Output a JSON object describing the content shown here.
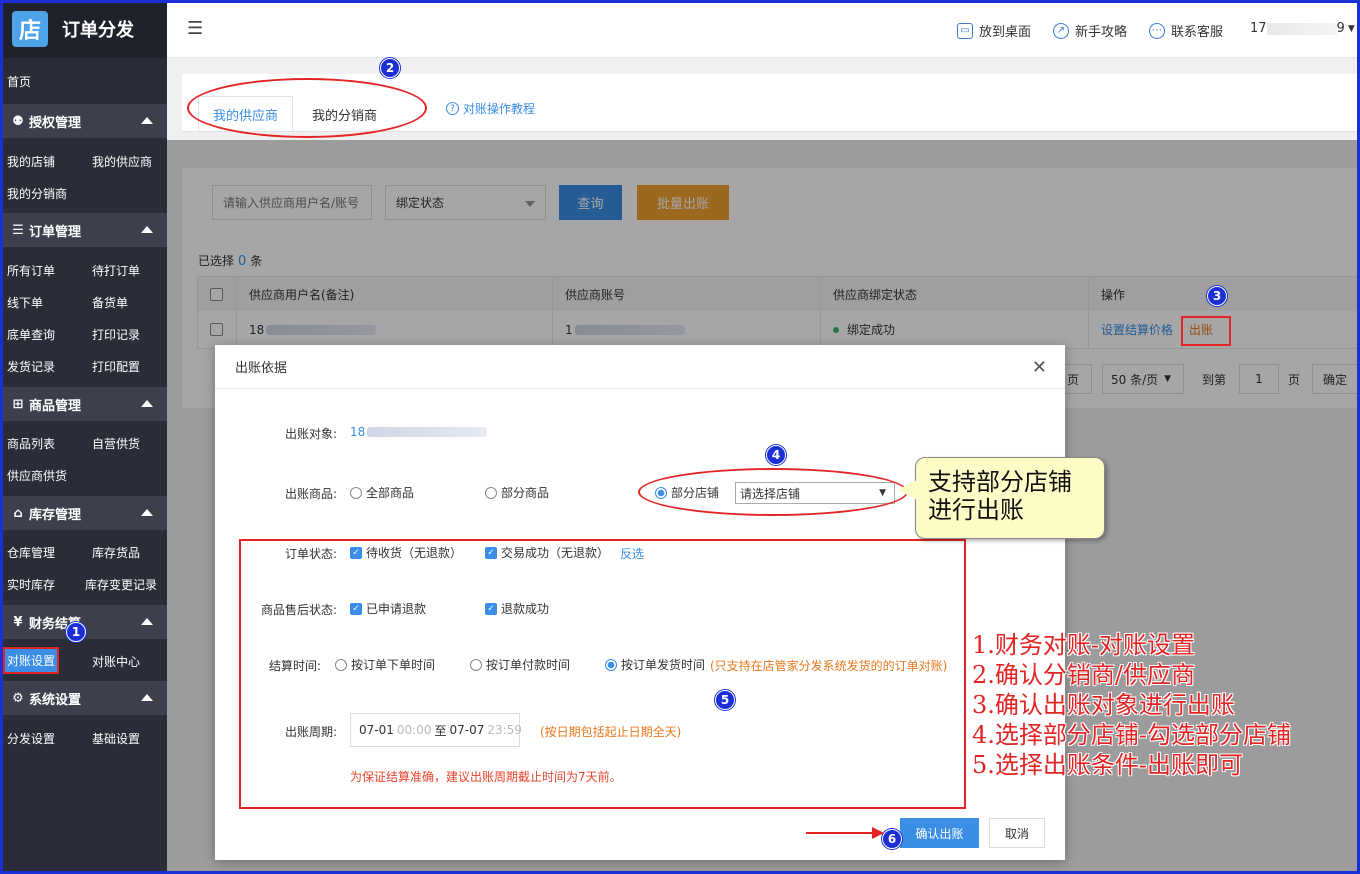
{
  "brand": {
    "logo": "店",
    "title": "订单分发"
  },
  "sidebar": {
    "home": "首页",
    "sections": [
      {
        "title": "授权管理",
        "icon": "user-key-icon",
        "items": [
          "我的店铺",
          "我的供应商",
          "我的分销商"
        ]
      },
      {
        "title": "订单管理",
        "icon": "order-icon",
        "items": [
          "所有订单",
          "待打订单",
          "线下单",
          "备货单",
          "底单查询",
          "打印记录",
          "发货记录",
          "打印配置"
        ]
      },
      {
        "title": "商品管理",
        "icon": "grid-icon",
        "items": [
          "商品列表",
          "自营供货",
          "供应商供货"
        ]
      },
      {
        "title": "库存管理",
        "icon": "home-icon",
        "items": [
          "仓库管理",
          "库存货品",
          "实时库存",
          "库存变更记录"
        ]
      },
      {
        "title": "财务结算",
        "icon": "yen-icon",
        "items": [
          "对账设置",
          "对账中心"
        ]
      },
      {
        "title": "系统设置",
        "icon": "settings-icon",
        "items": [
          "分发设置",
          "基础设置"
        ]
      }
    ]
  },
  "topbar": {
    "actions": [
      "放到桌面",
      "新手攻略",
      "联系客服"
    ],
    "user_prefix": "17",
    "user_suffix": "9"
  },
  "tabs": {
    "items": [
      "我的供应商",
      "我的分销商"
    ],
    "active": 0,
    "help": "对账操作教程"
  },
  "filters": {
    "search_placeholder": "请输入供应商用户名/账号",
    "status_select": "绑定状态",
    "query_btn": "查询",
    "batch_btn": "批量出账"
  },
  "selection": {
    "prefix": "已选择",
    "count": "0",
    "suffix": "条"
  },
  "table": {
    "headers": [
      "供应商用户名(备注)",
      "供应商账号",
      "供应商绑定状态",
      "操作"
    ],
    "rows": [
      {
        "name_prefix": "18",
        "account_prefix": "1",
        "status": "绑定成功",
        "action1": "设置结算价格",
        "action2": "出账"
      }
    ]
  },
  "pager": {
    "page_label": "页",
    "page_size": "50 条/页",
    "goto": "到第",
    "page_no": "1",
    "page_unit": "页",
    "confirm": "确定"
  },
  "modal": {
    "title": "出账依据",
    "target_label": "出账对象:",
    "target_prefix": "18",
    "goods_label": "出账商品:",
    "goods_options": [
      "全部商品",
      "部分商品",
      "部分店铺"
    ],
    "store_select": "请选择店铺",
    "order_status_label": "订单状态:",
    "order_status_opts": [
      "待收货（无退款）",
      "交易成功（无退款）"
    ],
    "invert": "反选",
    "after_sale_label": "商品售后状态:",
    "after_sale_opts": [
      "已申请退款",
      "退款成功"
    ],
    "settle_label": "结算时间:",
    "settle_opts": [
      "按订单下单时间",
      "按订单付款时间",
      "按订单发货时间"
    ],
    "settle_note": "(只支持在店管家分发系统发货的的订单对账)",
    "period_label": "出账周期:",
    "period_start": "07-01",
    "period_start_time": "00:00",
    "period_to": "至",
    "period_end": "07-07",
    "period_end_time": "23:59",
    "period_note": "(按日期包括起止日期全天)",
    "warning": "为保证结算准确，建议出账周期截止时间为7天前。",
    "confirm_btn": "确认出账",
    "cancel_btn": "取消"
  },
  "annotations": {
    "badges": [
      "1",
      "2",
      "3",
      "4",
      "5",
      "6"
    ],
    "callout": [
      "支持部分店铺",
      "进行出账"
    ],
    "steps": [
      "1.财务对账-对账设置",
      "2.确认分销商/供应商",
      "3.确认出账对象进行出账",
      "4.选择部分店铺-勾选部分店铺",
      "5.选择出账条件-出账即可"
    ],
    "color": "#e32424",
    "badge_color": "#1c2fd6"
  }
}
